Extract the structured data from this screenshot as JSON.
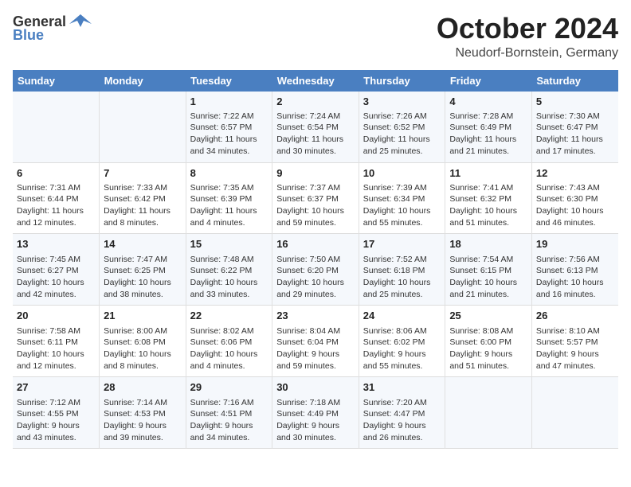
{
  "logo": {
    "general": "General",
    "blue": "Blue"
  },
  "title": "October 2024",
  "location": "Neudorf-Bornstein, Germany",
  "days_of_week": [
    "Sunday",
    "Monday",
    "Tuesday",
    "Wednesday",
    "Thursday",
    "Friday",
    "Saturday"
  ],
  "weeks": [
    [
      {
        "day": "",
        "detail": ""
      },
      {
        "day": "",
        "detail": ""
      },
      {
        "day": "1",
        "detail": "Sunrise: 7:22 AM\nSunset: 6:57 PM\nDaylight: 11 hours and 34 minutes."
      },
      {
        "day": "2",
        "detail": "Sunrise: 7:24 AM\nSunset: 6:54 PM\nDaylight: 11 hours and 30 minutes."
      },
      {
        "day": "3",
        "detail": "Sunrise: 7:26 AM\nSunset: 6:52 PM\nDaylight: 11 hours and 25 minutes."
      },
      {
        "day": "4",
        "detail": "Sunrise: 7:28 AM\nSunset: 6:49 PM\nDaylight: 11 hours and 21 minutes."
      },
      {
        "day": "5",
        "detail": "Sunrise: 7:30 AM\nSunset: 6:47 PM\nDaylight: 11 hours and 17 minutes."
      }
    ],
    [
      {
        "day": "6",
        "detail": "Sunrise: 7:31 AM\nSunset: 6:44 PM\nDaylight: 11 hours and 12 minutes."
      },
      {
        "day": "7",
        "detail": "Sunrise: 7:33 AM\nSunset: 6:42 PM\nDaylight: 11 hours and 8 minutes."
      },
      {
        "day": "8",
        "detail": "Sunrise: 7:35 AM\nSunset: 6:39 PM\nDaylight: 11 hours and 4 minutes."
      },
      {
        "day": "9",
        "detail": "Sunrise: 7:37 AM\nSunset: 6:37 PM\nDaylight: 10 hours and 59 minutes."
      },
      {
        "day": "10",
        "detail": "Sunrise: 7:39 AM\nSunset: 6:34 PM\nDaylight: 10 hours and 55 minutes."
      },
      {
        "day": "11",
        "detail": "Sunrise: 7:41 AM\nSunset: 6:32 PM\nDaylight: 10 hours and 51 minutes."
      },
      {
        "day": "12",
        "detail": "Sunrise: 7:43 AM\nSunset: 6:30 PM\nDaylight: 10 hours and 46 minutes."
      }
    ],
    [
      {
        "day": "13",
        "detail": "Sunrise: 7:45 AM\nSunset: 6:27 PM\nDaylight: 10 hours and 42 minutes."
      },
      {
        "day": "14",
        "detail": "Sunrise: 7:47 AM\nSunset: 6:25 PM\nDaylight: 10 hours and 38 minutes."
      },
      {
        "day": "15",
        "detail": "Sunrise: 7:48 AM\nSunset: 6:22 PM\nDaylight: 10 hours and 33 minutes."
      },
      {
        "day": "16",
        "detail": "Sunrise: 7:50 AM\nSunset: 6:20 PM\nDaylight: 10 hours and 29 minutes."
      },
      {
        "day": "17",
        "detail": "Sunrise: 7:52 AM\nSunset: 6:18 PM\nDaylight: 10 hours and 25 minutes."
      },
      {
        "day": "18",
        "detail": "Sunrise: 7:54 AM\nSunset: 6:15 PM\nDaylight: 10 hours and 21 minutes."
      },
      {
        "day": "19",
        "detail": "Sunrise: 7:56 AM\nSunset: 6:13 PM\nDaylight: 10 hours and 16 minutes."
      }
    ],
    [
      {
        "day": "20",
        "detail": "Sunrise: 7:58 AM\nSunset: 6:11 PM\nDaylight: 10 hours and 12 minutes."
      },
      {
        "day": "21",
        "detail": "Sunrise: 8:00 AM\nSunset: 6:08 PM\nDaylight: 10 hours and 8 minutes."
      },
      {
        "day": "22",
        "detail": "Sunrise: 8:02 AM\nSunset: 6:06 PM\nDaylight: 10 hours and 4 minutes."
      },
      {
        "day": "23",
        "detail": "Sunrise: 8:04 AM\nSunset: 6:04 PM\nDaylight: 9 hours and 59 minutes."
      },
      {
        "day": "24",
        "detail": "Sunrise: 8:06 AM\nSunset: 6:02 PM\nDaylight: 9 hours and 55 minutes."
      },
      {
        "day": "25",
        "detail": "Sunrise: 8:08 AM\nSunset: 6:00 PM\nDaylight: 9 hours and 51 minutes."
      },
      {
        "day": "26",
        "detail": "Sunrise: 8:10 AM\nSunset: 5:57 PM\nDaylight: 9 hours and 47 minutes."
      }
    ],
    [
      {
        "day": "27",
        "detail": "Sunrise: 7:12 AM\nSunset: 4:55 PM\nDaylight: 9 hours and 43 minutes."
      },
      {
        "day": "28",
        "detail": "Sunrise: 7:14 AM\nSunset: 4:53 PM\nDaylight: 9 hours and 39 minutes."
      },
      {
        "day": "29",
        "detail": "Sunrise: 7:16 AM\nSunset: 4:51 PM\nDaylight: 9 hours and 34 minutes."
      },
      {
        "day": "30",
        "detail": "Sunrise: 7:18 AM\nSunset: 4:49 PM\nDaylight: 9 hours and 30 minutes."
      },
      {
        "day": "31",
        "detail": "Sunrise: 7:20 AM\nSunset: 4:47 PM\nDaylight: 9 hours and 26 minutes."
      },
      {
        "day": "",
        "detail": ""
      },
      {
        "day": "",
        "detail": ""
      }
    ]
  ]
}
